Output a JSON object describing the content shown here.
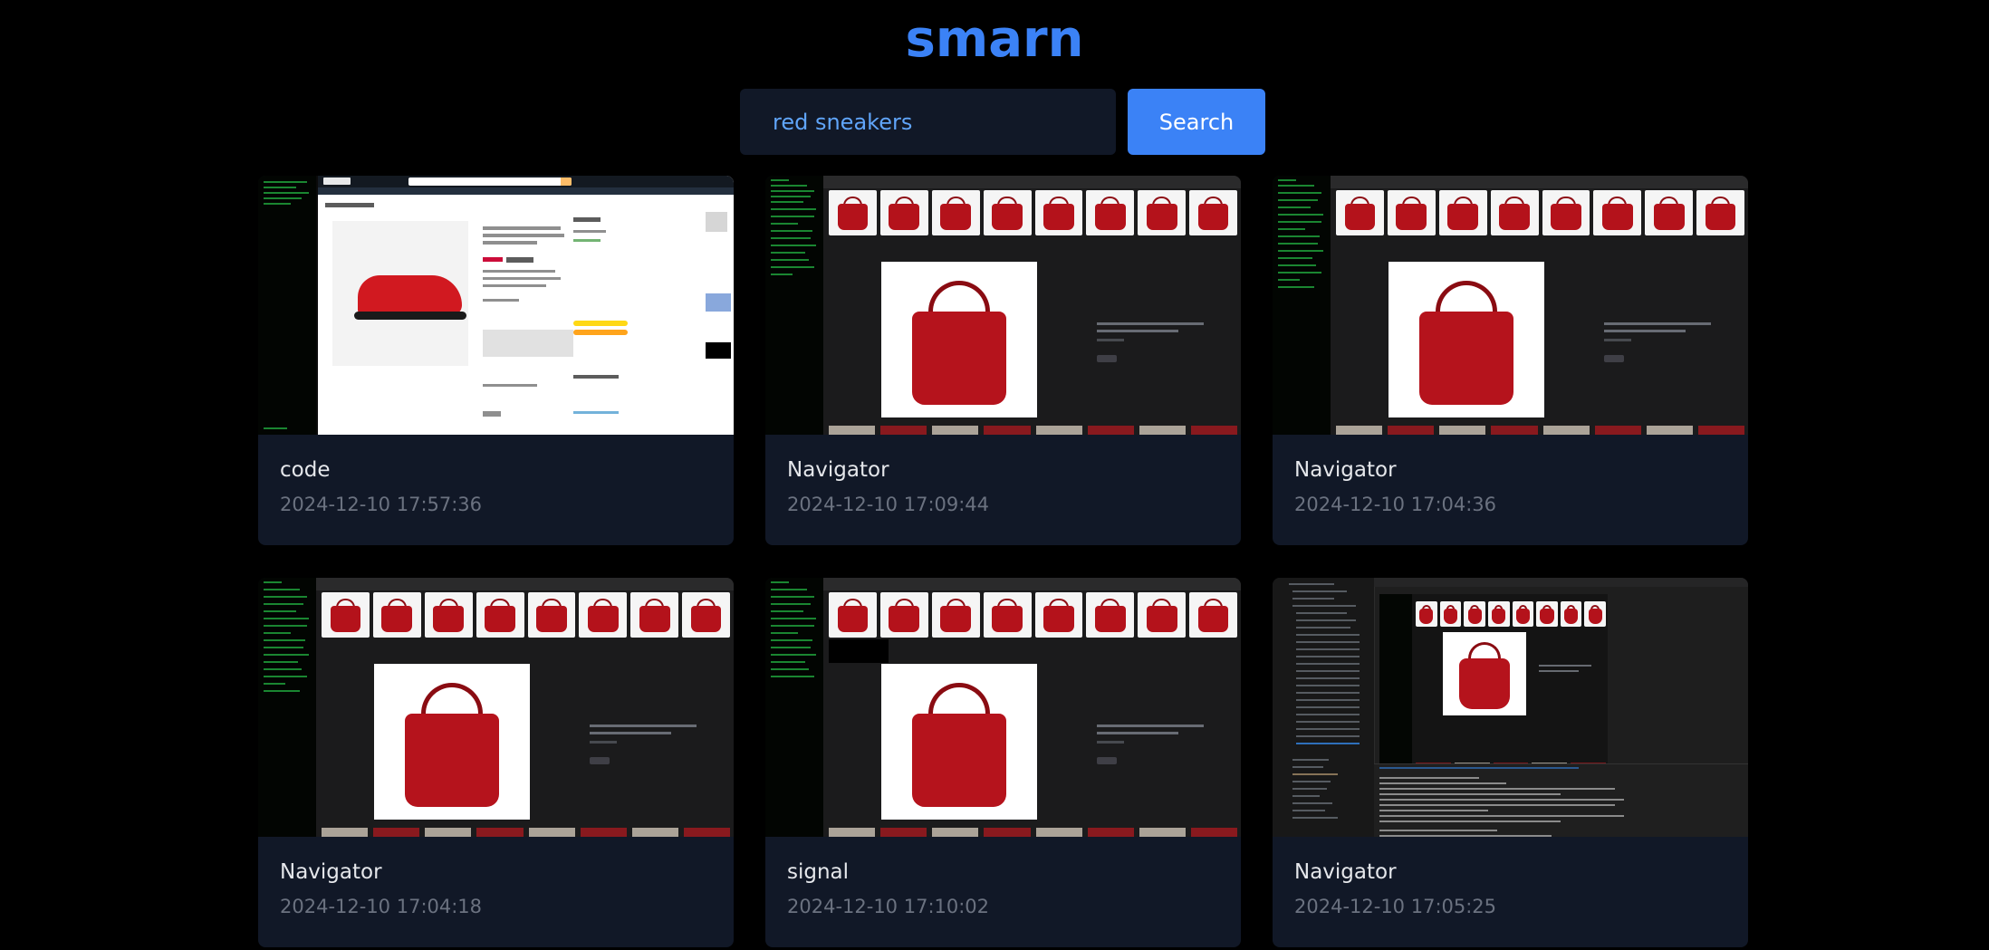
{
  "app": {
    "logo": "smarn"
  },
  "search": {
    "value": "red sneakers",
    "placeholder": "",
    "button_label": "Search"
  },
  "results": [
    {
      "title": "code",
      "date": "2024-12-10 17:57:36",
      "thumbnail": "amazon-shoe"
    },
    {
      "title": "Navigator",
      "date": "2024-12-10 17:09:44",
      "thumbnail": "bag-search"
    },
    {
      "title": "Navigator",
      "date": "2024-12-10 17:04:36",
      "thumbnail": "bag-search"
    },
    {
      "title": "Navigator",
      "date": "2024-12-10 17:04:18",
      "thumbnail": "bag-search"
    },
    {
      "title": "signal",
      "date": "2024-12-10 17:10:02",
      "thumbnail": "bag-search"
    },
    {
      "title": "Navigator",
      "date": "2024-12-10 17:05:25",
      "thumbnail": "vscode"
    }
  ],
  "colors": {
    "background": "#000000",
    "accent": "#3b82f6",
    "card": "#111827"
  }
}
